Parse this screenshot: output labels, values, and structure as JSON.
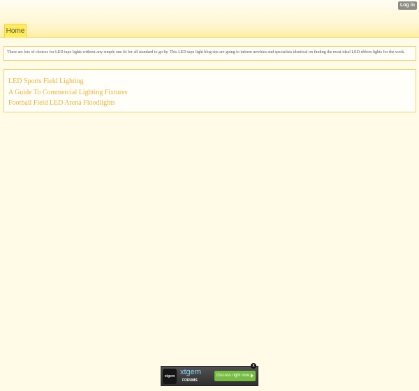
{
  "header": {
    "login_label": "Log in",
    "nav": {
      "home_label": "Home"
    }
  },
  "intro": {
    "text": "There are lots of choices for LED tape lights without any simple one fit for all standard to go by. This LED tape light blog site are going to inform newbies and specialists identical on finding the most ideal LED ribbon lights for the work."
  },
  "links": [
    {
      "label": "LED Sports Field Lighting"
    },
    {
      "label": "A Guide To Commercial Lighting Fixtures"
    },
    {
      "label": "Football Field LED Arena Floodlights"
    }
  ],
  "ad": {
    "logo_text": "xtgem",
    "brand": "xtgem",
    "sub": "FORUMS",
    "cta_label": "Discuss right now",
    "close_label": "x"
  },
  "colors": {
    "page_background": "#fffbe6",
    "link": "#f0b236",
    "tab": "#ffec5a",
    "cta": "#74bd3f"
  },
  "icons": {
    "close": "close-icon",
    "play": "play-arrow-icon"
  }
}
